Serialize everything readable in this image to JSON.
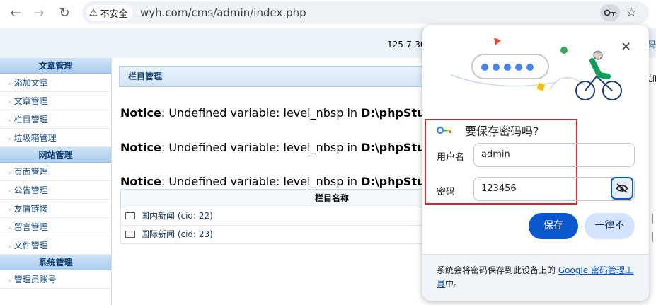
{
  "browser": {
    "back_glyph": "←",
    "forward_glyph": "→",
    "reload_glyph": "↻",
    "security_label": "不安全",
    "url": "wyh.com/cms/admin/index.php",
    "star_glyph": "☆"
  },
  "header": {
    "date_text": "125-7-30",
    "right_cut_text": "码"
  },
  "sidebar": {
    "sections": [
      {
        "title": "文章管理",
        "items": [
          "添加文章",
          "文章管理",
          "栏目管理",
          "垃圾箱管理"
        ]
      },
      {
        "title": "网站管理",
        "items": [
          "页面管理",
          "公告管理",
          "友情链接",
          "留言管理",
          "文件管理"
        ]
      },
      {
        "title": "系统管理",
        "items": [
          "管理员账号"
        ]
      }
    ]
  },
  "main": {
    "panel_title": "栏目管理",
    "right_cut_label": "加",
    "notices": [
      {
        "prefix": "Notice",
        "message": ": Undefined variable: level_nbsp in ",
        "path": "D:\\phpStudy\\W"
      },
      {
        "prefix": "Notice",
        "message": ": Undefined variable: level_nbsp in ",
        "path": "D:\\phpStudy\\W"
      },
      {
        "prefix": "Notice",
        "message": ": Undefined variable: level_nbsp in ",
        "path": "D:\\phpStudy\\W"
      }
    ],
    "table": {
      "header": "栏目名称",
      "rows": [
        "国内新闻  (cid: 22)",
        "国际新闻  (cid: 23)"
      ]
    }
  },
  "password_dialog": {
    "close_glyph": "✕",
    "title": "要保存密码吗?",
    "username_label": "用户名",
    "username_value": "admin",
    "password_label": "密码",
    "password_value": "123456",
    "save_label": "保存",
    "never_label": "一律不",
    "footer_prefix": "系统会将密码保存到此设备上的 ",
    "footer_link": "Google 密码管理工具",
    "footer_suffix": "中。",
    "accent_color": "#0b57d0",
    "highlight_border_color": "#d9262c"
  }
}
